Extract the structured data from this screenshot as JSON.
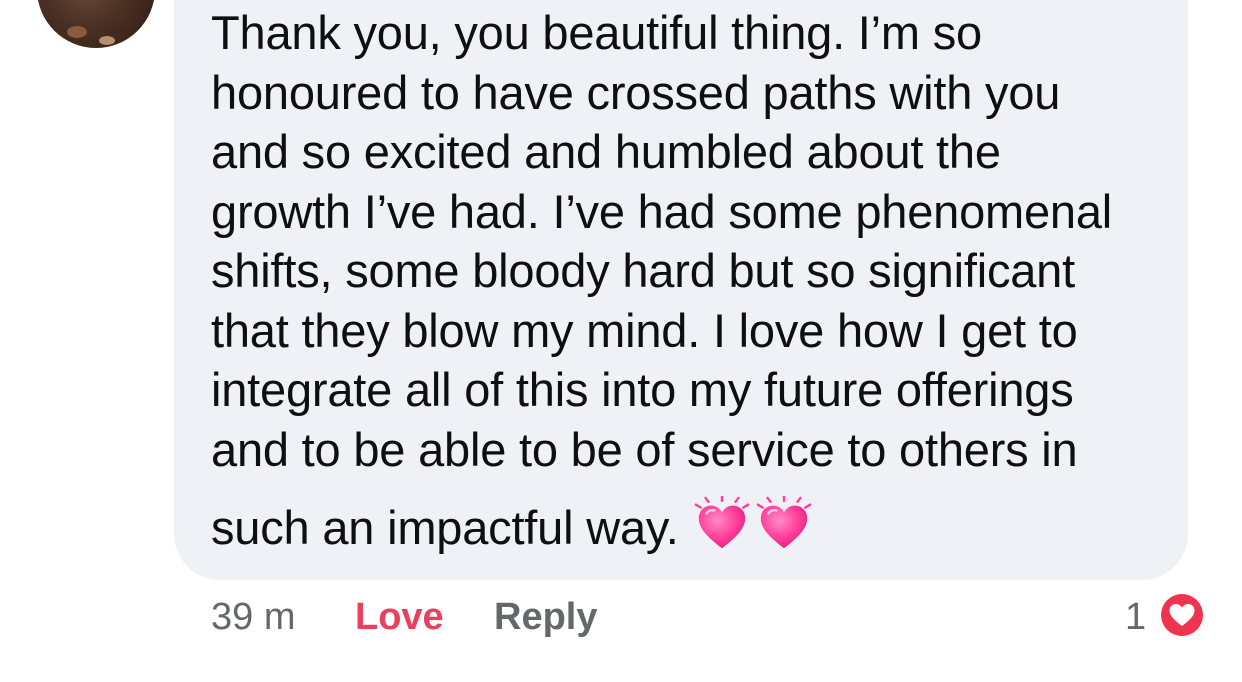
{
  "comment": {
    "lines": [
      "Thank you, you beautiful thing. I’m so",
      "honoured to have crossed paths with you",
      "and so excited and humbled about the",
      "growth I’ve had. I’ve had some phenomenal",
      "shifts, some bloody hard but so significant",
      "that they blow my mind. I love how I get to",
      "integrate all of this into my future offerings",
      "and to be able to be of service to others in"
    ],
    "last_line": "such an impactful way.",
    "emojis": [
      "growing-heart-emoji",
      "growing-heart-emoji"
    ]
  },
  "footer": {
    "time": "39 m",
    "love_label": "Love",
    "reply_label": "Reply",
    "reaction_count": "1",
    "reaction_icon": "love-reaction-icon"
  },
  "colors": {
    "bubble_bg": "#f0f1f6",
    "love_red": "#e8415e",
    "meta_gray": "#65676b",
    "heart_pink": "#ff4fa3"
  }
}
